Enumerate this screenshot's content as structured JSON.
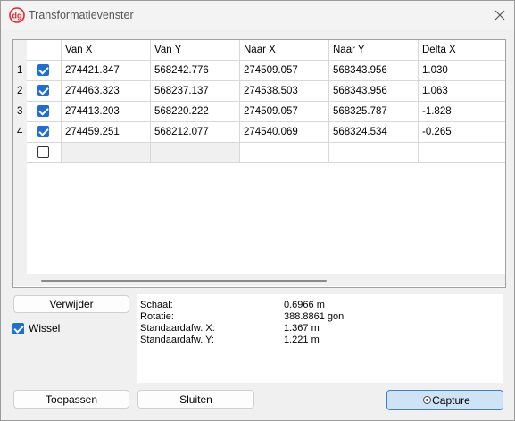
{
  "window": {
    "title": "Transformatievenster"
  },
  "grid": {
    "columns": [
      "Van X",
      "Van Y",
      "Naar X",
      "Naar Y",
      "Delta X"
    ],
    "rows": [
      {
        "num": "1",
        "checked": true,
        "cells": [
          "274421.347",
          "568242.776",
          "274509.057",
          "568343.956",
          "1.030"
        ]
      },
      {
        "num": "2",
        "checked": true,
        "cells": [
          "274463.323",
          "568237.137",
          "274538.503",
          "568343.956",
          "1.063"
        ]
      },
      {
        "num": "3",
        "checked": true,
        "cells": [
          "274413.203",
          "568220.222",
          "274509.057",
          "568325.787",
          "-1.828"
        ]
      },
      {
        "num": "4",
        "checked": true,
        "cells": [
          "274459.251",
          "568212.077",
          "274540.069",
          "568324.534",
          "-0.265"
        ]
      }
    ],
    "new_row": {
      "checked": false
    }
  },
  "buttons": {
    "remove": "Verwijder",
    "apply": "Toepassen",
    "close": "Sluiten",
    "capture": "Capture"
  },
  "wissel": {
    "label": "Wissel",
    "checked": true
  },
  "stats": [
    {
      "label": "Schaal:",
      "value": "0.6966 m"
    },
    {
      "label": "Rotatie:",
      "value": "388.8861 gon"
    },
    {
      "label": "Standaardafw. X:",
      "value": "1.367 m"
    },
    {
      "label": "Standaardafw. Y:",
      "value": "1.221 m"
    }
  ],
  "colors": {
    "accent": "#1d6fd6",
    "logo": "#e0282b",
    "capture_bg": "#cfe3f7"
  },
  "icons": {
    "app": "dg-logo-icon",
    "close": "close-icon",
    "capture": "radio-dot-icon"
  }
}
